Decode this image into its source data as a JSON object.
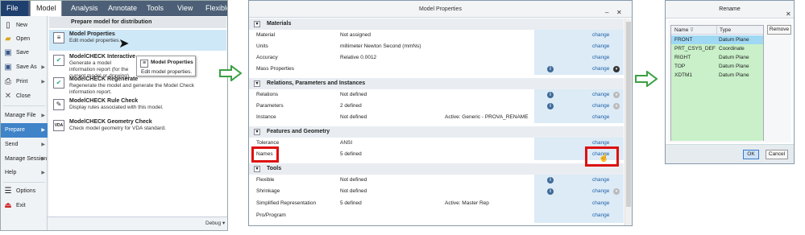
{
  "ribbon": {
    "tabs": [
      "File",
      "Model",
      "Analysis",
      "Annotate",
      "Tools",
      "View",
      "Flexible M"
    ]
  },
  "file_menu": {
    "items": [
      {
        "label": "New",
        "icon": "new-file-icon"
      },
      {
        "label": "Open",
        "icon": "folder-icon"
      },
      {
        "label": "Save",
        "icon": "save-icon"
      },
      {
        "label": "Save As",
        "icon": "save-as-icon"
      },
      {
        "label": "Print",
        "icon": "print-icon"
      },
      {
        "label": "Close",
        "icon": "close-icon"
      },
      {
        "label": "Manage File"
      },
      {
        "label": "Prepare"
      },
      {
        "label": "Send"
      },
      {
        "label": "Manage Session"
      },
      {
        "label": "Help"
      },
      {
        "label": "Options",
        "icon": "options-icon"
      },
      {
        "label": "Exit",
        "icon": "exit-icon"
      }
    ],
    "submenu_title": "Prepare model for distribution",
    "submenu": [
      {
        "title": "Model Properties",
        "desc": "Edit model properties."
      },
      {
        "title": "ModelCHECK Interactive",
        "desc": "Generate a model information report (for the current model or drawing)."
      },
      {
        "title": "ModelCHECK Regenerate",
        "desc": "Regenerate the model and generate the Model Check information report."
      },
      {
        "title": "ModelCHECK Rule Check",
        "desc": "Display rules associated with this model."
      },
      {
        "title": "ModelCHECK Geometry Check",
        "desc": "Check model geometry for VDA standard.",
        "icon_text": "VDA"
      }
    ],
    "tooltip": {
      "title": "Model Properties",
      "desc": "Edit model properties."
    },
    "bottom_text": "Debug ▾"
  },
  "model_properties": {
    "title": "Model Properties",
    "sections": [
      {
        "name": "Materials",
        "rows": [
          {
            "label": "Material",
            "value": "Not assigned",
            "change": "change"
          },
          {
            "label": "Units",
            "value": "millimeter Newton Second (mmNs)",
            "change": "change"
          },
          {
            "label": "Accuracy",
            "value": "Relative 0.0012",
            "change": "change"
          },
          {
            "label": "Mass Properties",
            "value": "",
            "change": "change"
          }
        ]
      },
      {
        "name": "Relations, Parameters and Instances",
        "rows": [
          {
            "label": "Relations",
            "value": "Not defined",
            "change": "change"
          },
          {
            "label": "Parameters",
            "value": "2 defined",
            "change": "change"
          },
          {
            "label": "Instance",
            "value": "Not defined",
            "extra": "Active: Generic - PROVA_RENAME",
            "change": "change"
          }
        ]
      },
      {
        "name": "Features and Geometry",
        "rows": [
          {
            "label": "Tolerance",
            "value": "ANSI",
            "change": "change"
          },
          {
            "label": "Names",
            "value": "5 defined",
            "change": "change"
          }
        ]
      },
      {
        "name": "Tools",
        "rows": [
          {
            "label": "Flexible",
            "value": "Not defined",
            "change": "change"
          },
          {
            "label": "Shrinkage",
            "value": "Not defined",
            "change": "change"
          },
          {
            "label": "Simplified Representation",
            "value": "5 defined",
            "extra": "Active: Master Rep",
            "change": "change"
          },
          {
            "label": "Pro/Program",
            "value": "",
            "change": "change"
          }
        ]
      }
    ]
  },
  "rename": {
    "title": "Rename",
    "columns": [
      "Name",
      "Type"
    ],
    "rows": [
      {
        "name": "FRONT",
        "type": "Datum Plane"
      },
      {
        "name": "PRT_CSYS_DEF",
        "type": "Coordinate System"
      },
      {
        "name": "RIGHT",
        "type": "Datum Plane"
      },
      {
        "name": "TOP",
        "type": "Datum Plane"
      },
      {
        "name": "XDTM1",
        "type": "Datum Plane"
      }
    ],
    "remove_label": "Remove",
    "ok_label": "OK",
    "cancel_label": "Cancel"
  },
  "colors": {
    "accent": "#3f83c8",
    "highlight_red": "#dd1111",
    "arrow_green": "#3aa043",
    "link_blue": "#1f5fa8"
  }
}
